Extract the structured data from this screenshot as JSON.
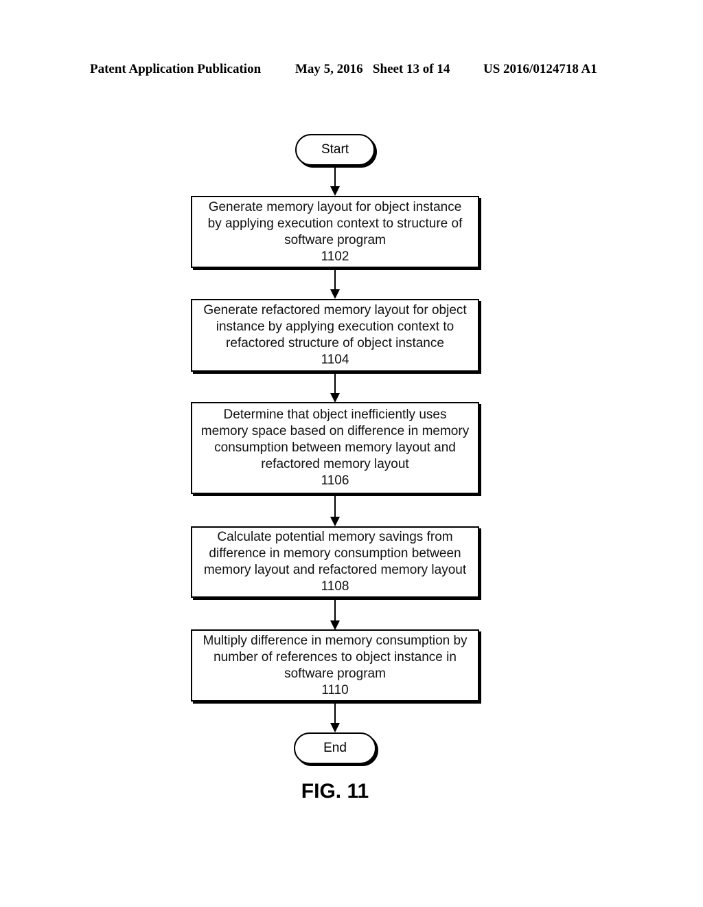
{
  "header": {
    "left": "Patent Application Publication",
    "middle": "May 5, 2016   Sheet 13 of 14",
    "right": "US 2016/0124718 A1"
  },
  "flowchart": {
    "start": "Start",
    "end": "End",
    "steps": [
      {
        "text": "Generate memory layout for object instance\nby applying execution context to structure of\nsoftware program",
        "ref": "1102"
      },
      {
        "text": "Generate refactored memory layout for object\ninstance by applying execution context to\nrefactored structure of object instance",
        "ref": "1104"
      },
      {
        "text": "Determine that object inefficiently uses\nmemory space based on difference in memory\nconsumption between memory layout and\nrefactored memory layout",
        "ref": "1106"
      },
      {
        "text": "Calculate potential memory savings from\ndifference in memory consumption between\nmemory layout and refactored memory layout",
        "ref": "1108"
      },
      {
        "text": "Multiply difference in memory consumption by\nnumber of references to object instance in\nsoftware program",
        "ref": "1110"
      }
    ]
  },
  "figure_label": "FIG. 11"
}
